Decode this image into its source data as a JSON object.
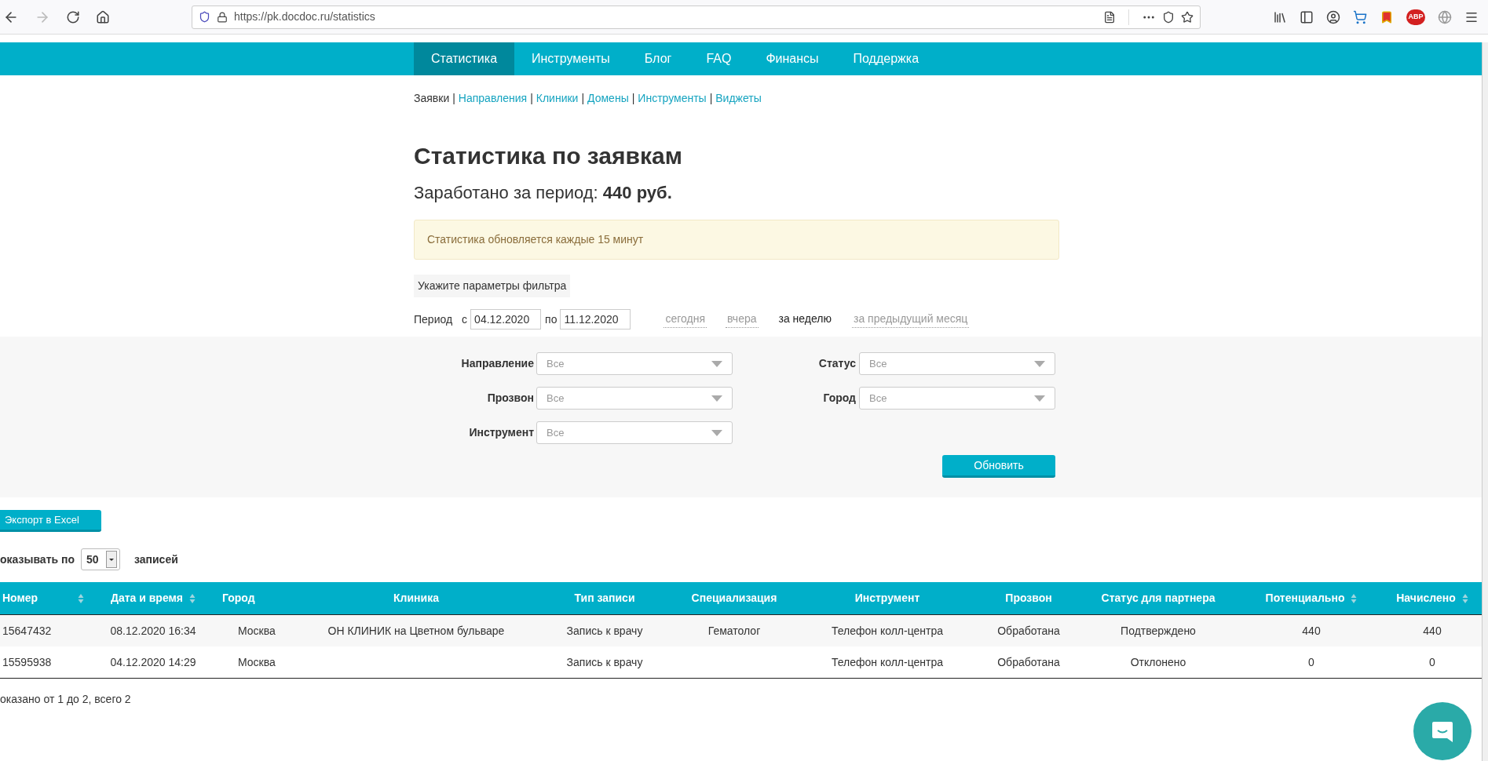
{
  "browser": {
    "url": "https://pk.docdoc.ru/statistics",
    "extension_badge": "ABP"
  },
  "nav": [
    {
      "label": "Статистика",
      "selected": true
    },
    {
      "label": "Инструменты",
      "selected": false
    },
    {
      "label": "Блог",
      "selected": false
    },
    {
      "label": "FAQ",
      "selected": false
    },
    {
      "label": "Финансы",
      "selected": false
    },
    {
      "label": "Поддержка",
      "selected": false
    }
  ],
  "subnav_separator": "|",
  "subnav": [
    {
      "label": "Заявки",
      "selected": true
    },
    {
      "label": "Направления",
      "selected": false
    },
    {
      "label": "Клиники",
      "selected": false
    },
    {
      "label": "Домены",
      "selected": false
    },
    {
      "label": "Инструменты",
      "selected": false
    },
    {
      "label": "Виджеты",
      "selected": false
    }
  ],
  "title": "Статистика по заявкам",
  "earned": "Заработано за период: **440 руб.**",
  "notice": "Статистика обновляется каждые 15 минут",
  "filter_heading": "Укажите параметры фильтра",
  "period": {
    "label": "Период",
    "from_label": "с",
    "from": "04.12.2020",
    "to_label": "по",
    "to": "11.12.2020",
    "presets": [
      {
        "label": "сегодня",
        "selected": false
      },
      {
        "label": "вчера",
        "selected": false
      },
      {
        "label": "за неделю",
        "selected": true
      },
      {
        "label": "за предыдущий месяц",
        "selected": false
      }
    ]
  },
  "filters": {
    "left": [
      {
        "label": "Направление",
        "value": "Все"
      },
      {
        "label": "Прозвон",
        "value": "Все"
      },
      {
        "label": "Инструмент",
        "value": "Все"
      }
    ],
    "right": [
      {
        "label": "Статус",
        "value": "Все"
      },
      {
        "label": "Город",
        "value": "Все"
      }
    ],
    "submit": "Обновить"
  },
  "export_button": "Экспорт в Excel",
  "page_size": {
    "prefix": "оказывать по",
    "value": "50",
    "suffix": "записей"
  },
  "table": {
    "columns": [
      {
        "label": "Номер",
        "sortable": true
      },
      {
        "label": "Дата и время",
        "sortable": true
      },
      {
        "label": "Город",
        "sortable": false
      },
      {
        "label": "Клиника",
        "sortable": false
      },
      {
        "label": "Тип записи",
        "sortable": false
      },
      {
        "label": "Специализация",
        "sortable": false
      },
      {
        "label": "Инструмент",
        "sortable": false
      },
      {
        "label": "Прозвон",
        "sortable": false
      },
      {
        "label": "Статус для партнера",
        "sortable": false
      },
      {
        "label": "Потенциально",
        "sortable": true
      },
      {
        "label": "Начислено",
        "sortable": true
      }
    ],
    "rows": [
      [
        "15647432",
        "08.12.2020 16:34",
        "Москва",
        "ОН КЛИНИК на Цветном бульваре",
        "Запись к врачу",
        "Гематолог",
        "Телефон колл-центра",
        "Обработана",
        "Подтверждено",
        "440",
        "440"
      ],
      [
        "15595938",
        "04.12.2020 14:29",
        "Москва",
        "",
        "Запись к врачу",
        "",
        "Телефон колл-центра",
        "Обработана",
        "Отклонено",
        "0",
        "0"
      ]
    ]
  },
  "footer": "оказано от 1 до 2, всего 2"
}
